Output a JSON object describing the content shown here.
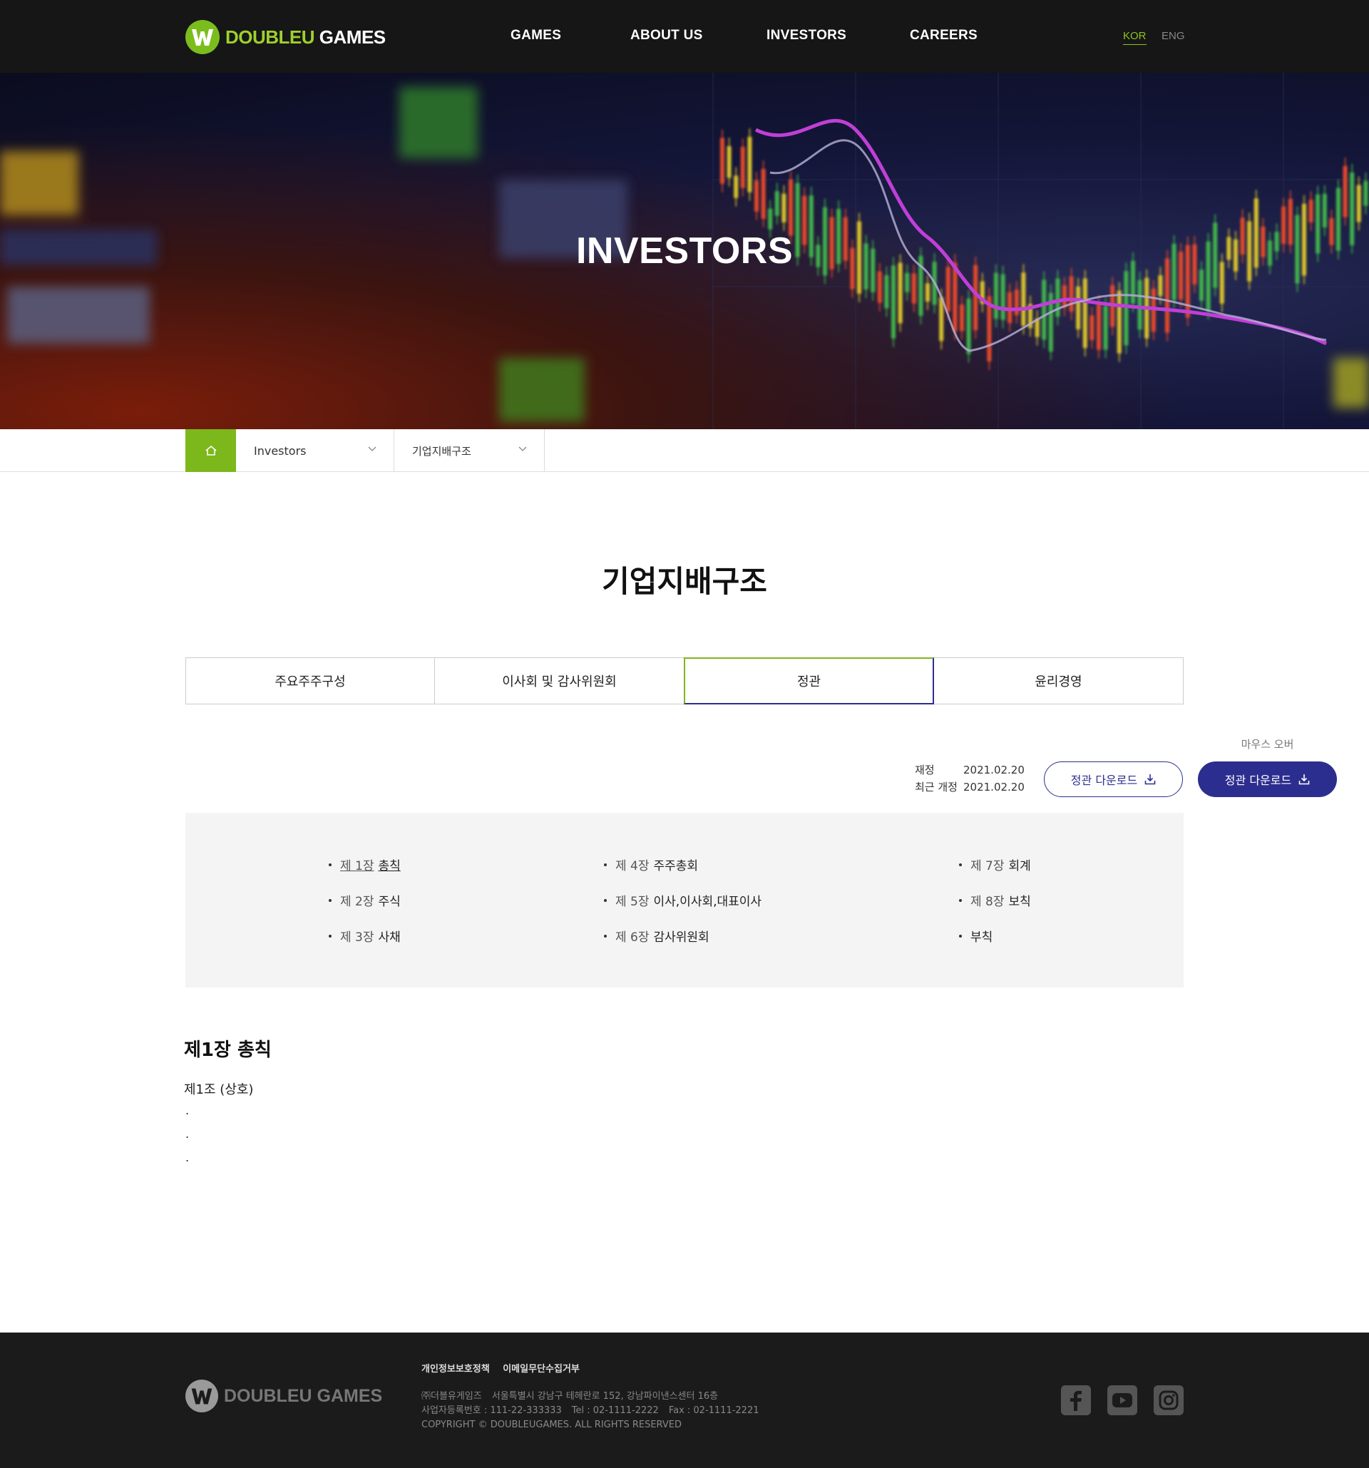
{
  "header": {
    "brand": {
      "part1": "DOUBLEU",
      "part2": " GAMES"
    },
    "nav": [
      "GAMES",
      "ABOUT US",
      "INVESTORS",
      "CAREERS"
    ],
    "lang": {
      "kor": "KOR",
      "eng": "ENG"
    }
  },
  "hero": {
    "title": "INVESTORS"
  },
  "breadcrumb": {
    "level1": "Investors",
    "level2": "기업지배구조"
  },
  "page": {
    "title": "기업지배구조"
  },
  "tabs": [
    "주요주주구성",
    "이사회 및 감사위원회",
    "정관",
    "윤리경영"
  ],
  "active_tab": "정관",
  "dates": {
    "established_label": "재정",
    "established": "2021.02.20",
    "revised_label": "최근 개정",
    "revised": "2021.02.20"
  },
  "buttons": {
    "download": "정관 다운로드",
    "download_hover": "정관 다운로드",
    "hover_caption": "마우스 오버"
  },
  "index": [
    {
      "num": "제 1장",
      "title": "총칙",
      "active": true
    },
    {
      "num": "제 2장",
      "title": "주식"
    },
    {
      "num": "제 3장",
      "title": "사채"
    },
    {
      "num": "제 4장",
      "title": "주주총회"
    },
    {
      "num": "제 5장",
      "title": "이사,이사회,대표이사"
    },
    {
      "num": "제 6장",
      "title": "감사위원회"
    },
    {
      "num": "제 7장",
      "title": "회계"
    },
    {
      "num": "제 8장",
      "title": "보칙"
    },
    {
      "num": "",
      "title": "부칙"
    }
  ],
  "article": {
    "title": "제1장 총칙",
    "subtitle": "제1조 (상호)",
    "lines": [
      ".",
      ".",
      "."
    ]
  },
  "footer": {
    "brand": {
      "part1": "DOUBLEU",
      "part2": " GAMES"
    },
    "links": [
      "개인정보보호정책",
      "이메일무단수집거부"
    ],
    "company": "㈜더블유게임즈",
    "address": "서울특별시 강남구 테헤란로 152, 강남파이낸스센터 16층",
    "biz_no": "사업자등록번호 : 111-22-333333",
    "tel": "Tel : 02-1111-2222",
    "fax": "Fax : 02-1111-2221",
    "copyright": "COPYRIGHT © DOUBLEUGAMES. ALL RIGHTS RESERVED",
    "social": [
      "facebook-icon",
      "youtube-icon",
      "instagram-icon"
    ]
  },
  "colors": {
    "brand_green": "#7cb81b",
    "primary_navy": "#2c2e8f",
    "header_bg": "#161616",
    "footer_bg": "#1b1b1b"
  }
}
